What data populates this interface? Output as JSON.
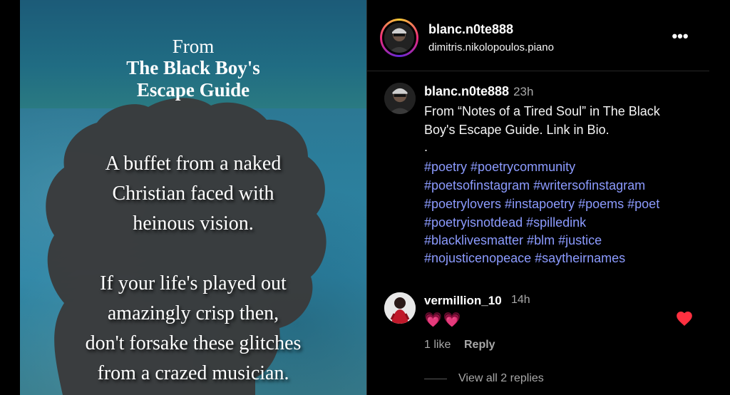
{
  "cover": {
    "from": "From",
    "title_line1": "The Black Boy's",
    "title_line2": "Escape Guide",
    "poem_lines": [
      "A buffet from a naked",
      "Christian faced with",
      "heinous vision.",
      "If your life's played out",
      "amazingly crisp then,",
      "don't forsake these glitches",
      "from a crazed musician."
    ]
  },
  "post": {
    "username": "blanc.n0te888",
    "audio": "dimitris.nikolopoulos.piano",
    "more_icon": "more-horizontal-icon"
  },
  "caption": {
    "username": "blanc.n0te888",
    "time": "23h",
    "lines": [
      "From “Notes of a Tired Soul” in The Black",
      "Boy's Escape Guide. Link in Bio.",
      "."
    ],
    "hashtag_lines": [
      "#poetry #poetrycommunity",
      "#poetsofinstagram #writersofinstagram",
      "#poetrylovers #instapoetry #poems #poet",
      "#poetryisnotdead #spilledink",
      "#blacklivesmatter #blm #justice",
      "#nojusticenopeace #saytheirnames"
    ],
    "hashtag_color": "#8c9bff"
  },
  "comment": {
    "username": "vermillion_10",
    "time": "14h",
    "text": "💗💗",
    "likes": "1 like",
    "reply_label": "Reply",
    "view_replies": "View all 2 replies",
    "liked": true,
    "heart_color": "#ff3040"
  }
}
